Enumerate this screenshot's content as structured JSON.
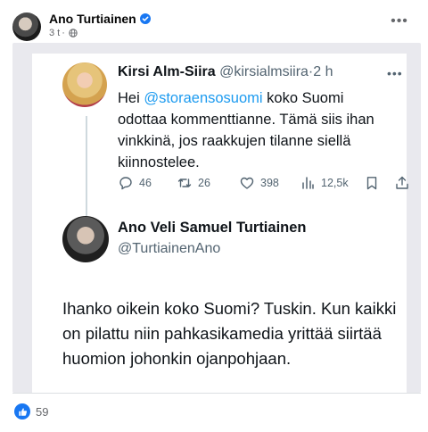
{
  "post": {
    "author": "Ano Turtiainen",
    "time": "3 t",
    "meta_separator": "·"
  },
  "embed": {
    "tweet1": {
      "name": "Kirsi Alm-Siira",
      "handle": "@kirsialmsiira",
      "separator": "·",
      "time": "2 h",
      "text_before": "Hei ",
      "mention": "@storaensosuomi",
      "text_after": " koko Suomi odottaa kommenttianne. Tämä siis ihan vinkkinä, jos raakkujen tilanne siellä kiinnostelee.",
      "replies": "46",
      "retweets": "26",
      "likes": "398",
      "views": "12,5k"
    },
    "tweet2": {
      "name": "Ano Veli Samuel Turtiainen",
      "handle": "@TurtiainenAno",
      "text": "Ihanko oikein koko Suomi? Tuskin. Kun kaikki on pilattu niin pahkasikamedia yrittää siirtää huomion johonkin ojanpohjaan."
    }
  },
  "reactions": {
    "count": "59"
  },
  "colors": {
    "link": "#1d9bf0",
    "like_badge": "#1877f2",
    "secondary_text": "#536471"
  }
}
